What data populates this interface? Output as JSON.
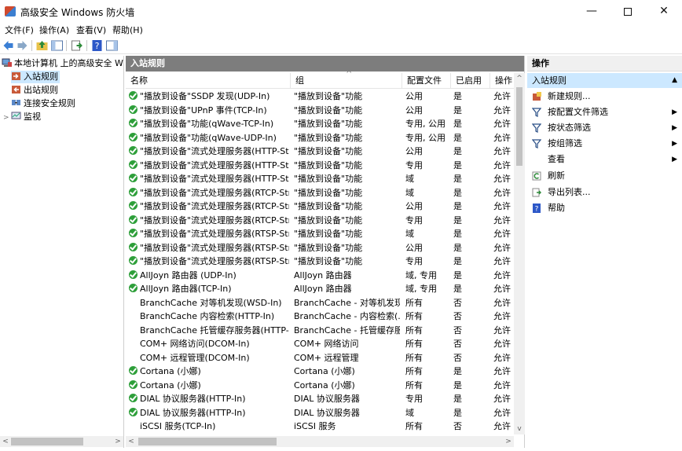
{
  "window": {
    "title": "高级安全 Windows 防火墙",
    "minimize": "—",
    "close": "✕"
  },
  "menu": [
    "文件(F)",
    "操作(A)",
    "查看(V)",
    "帮助(H)"
  ],
  "tree": {
    "root": "本地计算机 上的高级安全 Wind",
    "items": [
      {
        "label": "入站规则",
        "icon": "inbound-rules-icon",
        "selected": true
      },
      {
        "label": "出站规则",
        "icon": "outbound-rules-icon",
        "selected": false
      },
      {
        "label": "连接安全规则",
        "icon": "connection-security-icon",
        "selected": false
      },
      {
        "label": "监视",
        "icon": "monitor-icon",
        "selected": false
      }
    ]
  },
  "center": {
    "header": "入站规则",
    "columns": [
      "名称",
      "组",
      "配置文件",
      "已启用",
      "操作"
    ],
    "rows": [
      {
        "enabled_icon": true,
        "name": "\"播放到设备\"SSDP 发现(UDP-In)",
        "group": "\"播放到设备\"功能",
        "profile": "公用",
        "enabled": "是",
        "action": "允许"
      },
      {
        "enabled_icon": true,
        "name": "\"播放到设备\"UPnP 事件(TCP-In)",
        "group": "\"播放到设备\"功能",
        "profile": "公用",
        "enabled": "是",
        "action": "允许"
      },
      {
        "enabled_icon": true,
        "name": "\"播放到设备\"功能(qWave-TCP-In)",
        "group": "\"播放到设备\"功能",
        "profile": "专用, 公用",
        "enabled": "是",
        "action": "允许"
      },
      {
        "enabled_icon": true,
        "name": "\"播放到设备\"功能(qWave-UDP-In)",
        "group": "\"播放到设备\"功能",
        "profile": "专用, 公用",
        "enabled": "是",
        "action": "允许"
      },
      {
        "enabled_icon": true,
        "name": "\"播放到设备\"流式处理服务器(HTTP-Stre...",
        "group": "\"播放到设备\"功能",
        "profile": "公用",
        "enabled": "是",
        "action": "允许"
      },
      {
        "enabled_icon": true,
        "name": "\"播放到设备\"流式处理服务器(HTTP-Stre...",
        "group": "\"播放到设备\"功能",
        "profile": "专用",
        "enabled": "是",
        "action": "允许"
      },
      {
        "enabled_icon": true,
        "name": "\"播放到设备\"流式处理服务器(HTTP-Stre...",
        "group": "\"播放到设备\"功能",
        "profile": "域",
        "enabled": "是",
        "action": "允许"
      },
      {
        "enabled_icon": true,
        "name": "\"播放到设备\"流式处理服务器(RTCP-Stre...",
        "group": "\"播放到设备\"功能",
        "profile": "域",
        "enabled": "是",
        "action": "允许"
      },
      {
        "enabled_icon": true,
        "name": "\"播放到设备\"流式处理服务器(RTCP-Stre...",
        "group": "\"播放到设备\"功能",
        "profile": "公用",
        "enabled": "是",
        "action": "允许"
      },
      {
        "enabled_icon": true,
        "name": "\"播放到设备\"流式处理服务器(RTCP-Stre...",
        "group": "\"播放到设备\"功能",
        "profile": "专用",
        "enabled": "是",
        "action": "允许"
      },
      {
        "enabled_icon": true,
        "name": "\"播放到设备\"流式处理服务器(RTSP-Stre...",
        "group": "\"播放到设备\"功能",
        "profile": "域",
        "enabled": "是",
        "action": "允许"
      },
      {
        "enabled_icon": true,
        "name": "\"播放到设备\"流式处理服务器(RTSP-Stre...",
        "group": "\"播放到设备\"功能",
        "profile": "公用",
        "enabled": "是",
        "action": "允许"
      },
      {
        "enabled_icon": true,
        "name": "\"播放到设备\"流式处理服务器(RTSP-Stre...",
        "group": "\"播放到设备\"功能",
        "profile": "专用",
        "enabled": "是",
        "action": "允许"
      },
      {
        "enabled_icon": true,
        "name": "AllJoyn 路由器 (UDP-In)",
        "group": "AllJoyn 路由器",
        "profile": "域, 专用",
        "enabled": "是",
        "action": "允许"
      },
      {
        "enabled_icon": true,
        "name": "AllJoyn 路由器(TCP-In)",
        "group": "AllJoyn 路由器",
        "profile": "域, 专用",
        "enabled": "是",
        "action": "允许"
      },
      {
        "enabled_icon": false,
        "name": "BranchCache 对等机发现(WSD-In)",
        "group": "BranchCache - 对等机发现...",
        "profile": "所有",
        "enabled": "否",
        "action": "允许"
      },
      {
        "enabled_icon": false,
        "name": "BranchCache 内容检索(HTTP-In)",
        "group": "BranchCache - 内容检索(...",
        "profile": "所有",
        "enabled": "否",
        "action": "允许"
      },
      {
        "enabled_icon": false,
        "name": "BranchCache 托管缓存服务器(HTTP-In)",
        "group": "BranchCache - 托管缓存服...",
        "profile": "所有",
        "enabled": "否",
        "action": "允许"
      },
      {
        "enabled_icon": false,
        "name": "COM+ 网络访问(DCOM-In)",
        "group": "COM+ 网络访问",
        "profile": "所有",
        "enabled": "否",
        "action": "允许"
      },
      {
        "enabled_icon": false,
        "name": "COM+ 远程管理(DCOM-In)",
        "group": "COM+ 远程管理",
        "profile": "所有",
        "enabled": "否",
        "action": "允许"
      },
      {
        "enabled_icon": true,
        "name": "Cortana (小娜)",
        "group": "Cortana (小娜)",
        "profile": "所有",
        "enabled": "是",
        "action": "允许"
      },
      {
        "enabled_icon": true,
        "name": "Cortana (小娜)",
        "group": "Cortana (小娜)",
        "profile": "所有",
        "enabled": "是",
        "action": "允许"
      },
      {
        "enabled_icon": true,
        "name": "DIAL 协议服务器(HTTP-In)",
        "group": "DIAL 协议服务器",
        "profile": "专用",
        "enabled": "是",
        "action": "允许"
      },
      {
        "enabled_icon": true,
        "name": "DIAL 协议服务器(HTTP-In)",
        "group": "DIAL 协议服务器",
        "profile": "域",
        "enabled": "是",
        "action": "允许"
      },
      {
        "enabled_icon": false,
        "name": "iSCSI 服务(TCP-In)",
        "group": "iSCSI 服务",
        "profile": "所有",
        "enabled": "否",
        "action": "允许"
      }
    ]
  },
  "actions": {
    "header": "操作",
    "section": "入站规则",
    "items": [
      {
        "label": "新建规则...",
        "icon": "new-rule-icon",
        "submenu": false
      },
      {
        "label": "按配置文件筛选",
        "icon": "filter-icon",
        "submenu": true
      },
      {
        "label": "按状态筛选",
        "icon": "filter-icon",
        "submenu": true
      },
      {
        "label": "按组筛选",
        "icon": "filter-icon",
        "submenu": true
      },
      {
        "label": "查看",
        "icon": "",
        "submenu": true
      },
      {
        "label": "刷新",
        "icon": "refresh-icon",
        "submenu": false
      },
      {
        "label": "导出列表...",
        "icon": "export-icon",
        "submenu": false
      },
      {
        "label": "帮助",
        "icon": "help-icon",
        "submenu": false
      }
    ]
  },
  "colors": {
    "selected_bg": "#cce8ff",
    "header_gray": "#7d7d7d",
    "check_green": "#2e9f3a"
  }
}
